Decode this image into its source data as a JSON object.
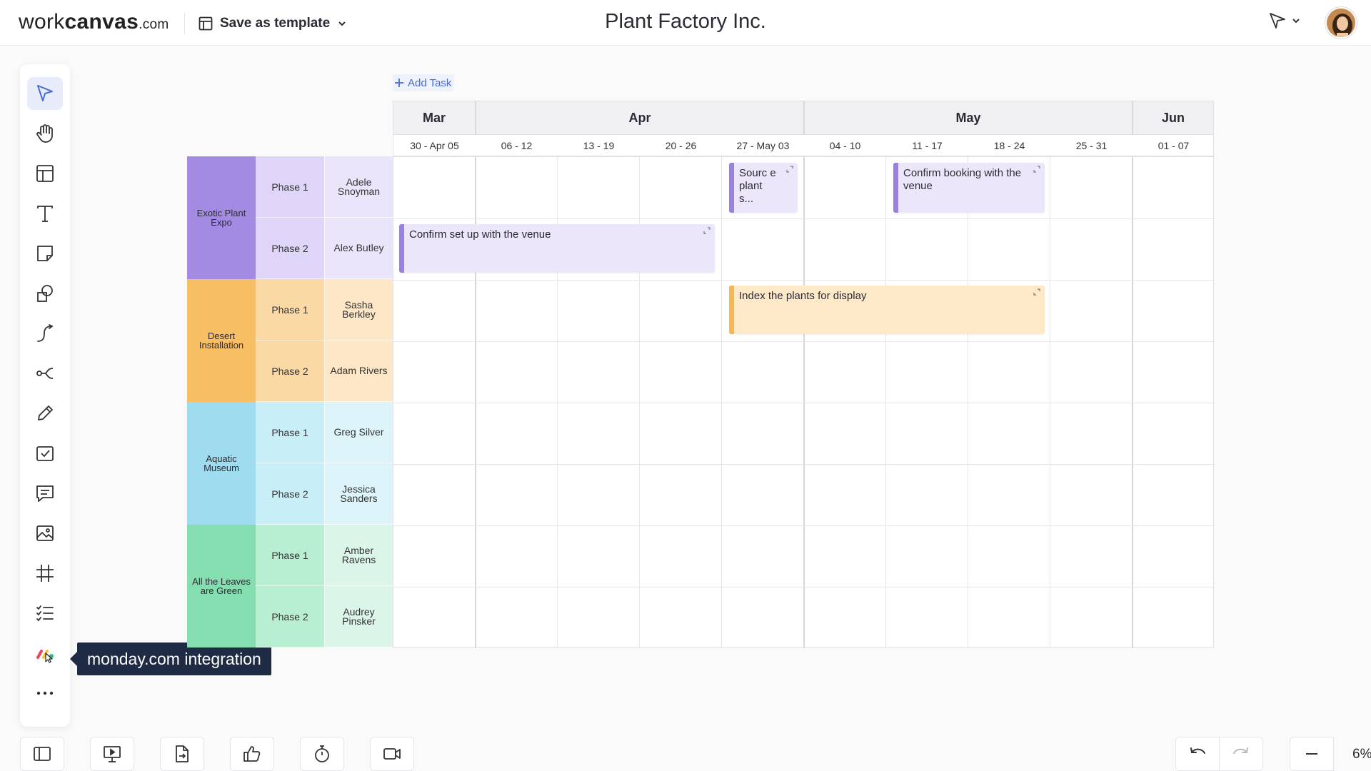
{
  "app": {
    "logo_main": "work",
    "logo_bold": "canvas",
    "logo_domain": ".com",
    "save_template_label": "Save as template",
    "board_title": "Plant Factory Inc."
  },
  "toolbar": {
    "tools": [
      {
        "name": "select-tool",
        "icon": "cursor-icon",
        "active": true
      },
      {
        "name": "hand-tool",
        "icon": "hand-icon"
      },
      {
        "name": "templates-tool",
        "icon": "layout-icon"
      },
      {
        "name": "text-tool",
        "icon": "text-icon"
      },
      {
        "name": "sticky-note-tool",
        "icon": "sticky-note-icon"
      },
      {
        "name": "shapes-tool",
        "icon": "shapes-icon"
      },
      {
        "name": "connector-tool",
        "icon": "connector-icon"
      },
      {
        "name": "mind-map-tool",
        "icon": "mind-map-icon"
      },
      {
        "name": "pen-tool",
        "icon": "pencil-icon"
      },
      {
        "name": "task-tool",
        "icon": "checkbox-icon"
      },
      {
        "name": "comment-tool",
        "icon": "comment-icon"
      },
      {
        "name": "image-tool",
        "icon": "image-icon"
      },
      {
        "name": "frame-tool",
        "icon": "frame-icon"
      },
      {
        "name": "checklist-tool",
        "icon": "checklist-icon"
      },
      {
        "name": "monday-integration-tool",
        "icon": "monday-icon"
      },
      {
        "name": "more-tool",
        "icon": "more-icon"
      }
    ],
    "tooltip": "monday.com integration"
  },
  "timeline": {
    "add_task_label": "Add Task",
    "months": [
      "Mar",
      "Apr",
      "May",
      "Jun"
    ],
    "weeks": [
      "30 - Apr 05",
      "06 - 12",
      "13 - 19",
      "20 - 26",
      "27 - May 03",
      "04 - 10",
      "11 - 17",
      "18 - 24",
      "25 - 31",
      "01 - 07"
    ],
    "groups": [
      {
        "name": "Exotic Plant Expo",
        "color": "#a38be4",
        "phase_color": "#ded5f8",
        "person_color": "#ebe5fb",
        "rows": [
          {
            "phase": "Phase 1",
            "person": "Adele Snoyman"
          },
          {
            "phase": "Phase 2",
            "person": "Alex Butley"
          }
        ]
      },
      {
        "name": "Desert Installation",
        "color": "#f7be64",
        "phase_color": "#fbd9a5",
        "person_color": "#fde7c6",
        "rows": [
          {
            "phase": "Phase 1",
            "person": "Sasha Berkley"
          },
          {
            "phase": "Phase 2",
            "person": "Adam Rivers"
          }
        ]
      },
      {
        "name": "Aquatic Museum",
        "color": "#9fdcef",
        "phase_color": "#c8eef8",
        "person_color": "#ddf4fa",
        "rows": [
          {
            "phase": "Phase 1",
            "person": "Greg Silver"
          },
          {
            "phase": "Phase 2",
            "person": "Jessica Sanders"
          }
        ]
      },
      {
        "name": "All the Leaves are Green",
        "color": "#84deaf",
        "phase_color": "#b8efd2",
        "person_color": "#dbf6e8",
        "rows": [
          {
            "phase": "Phase 1",
            "person": "Amber Ravens"
          },
          {
            "phase": "Phase 2",
            "person": "Audrey Pinsker"
          }
        ]
      }
    ],
    "tasks": [
      {
        "title": "Sourc e plants...",
        "style": "purple"
      },
      {
        "title": "Confirm booking with the venue",
        "style": "purple"
      },
      {
        "title": "Confirm set up with the venue",
        "style": "purple"
      },
      {
        "title": "Index the plants for display",
        "style": "orange"
      }
    ]
  },
  "bottom_bar": {
    "buttons": [
      "sidebar-toggle-icon",
      "present-icon",
      "export-icon",
      "vote-icon",
      "timer-icon",
      "video-icon"
    ],
    "undo": "undo-icon",
    "redo": "redo-icon",
    "zoom_out": "minus-icon",
    "zoom_level": "6%"
  }
}
